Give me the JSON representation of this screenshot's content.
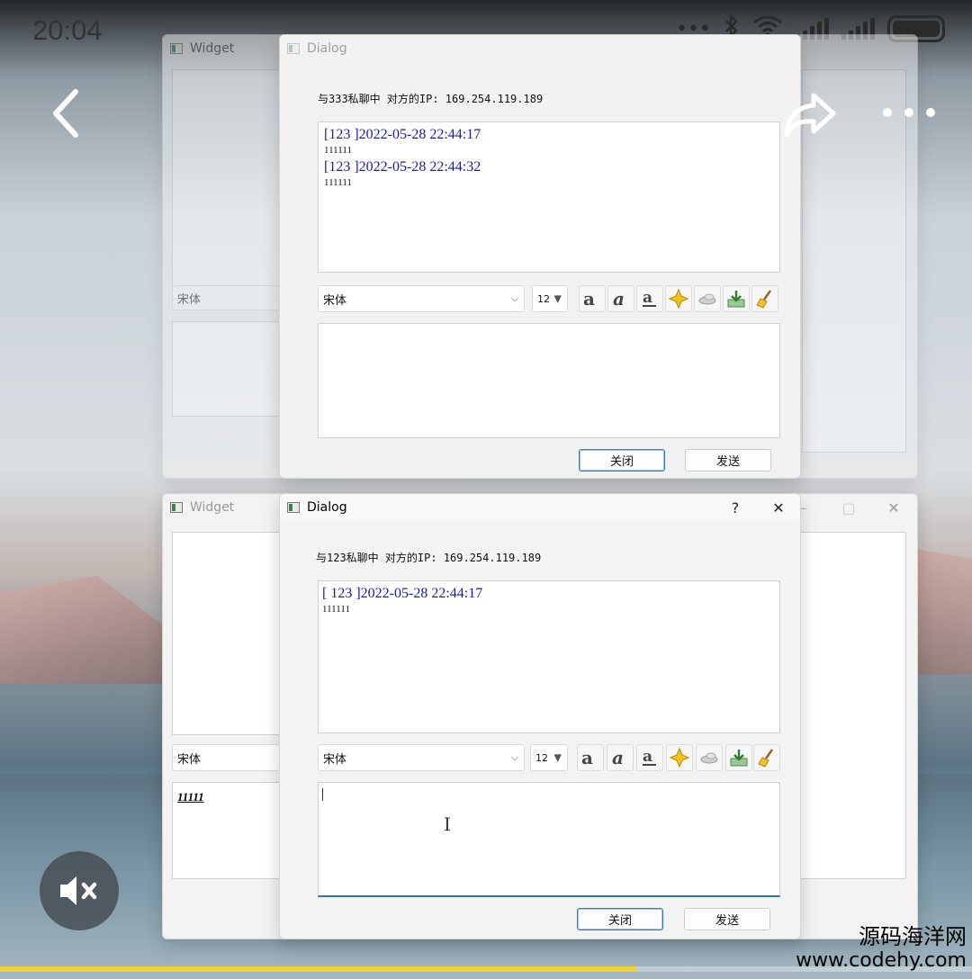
{
  "status_bar": {
    "time": "20:04"
  },
  "nav": {
    "back_icon": "chevron-left-icon",
    "share_icon": "share-icon",
    "more_icon": "more-icon"
  },
  "top_widget": {
    "title": "Widget",
    "font_combo": "宋体"
  },
  "top_dialog": {
    "title": "Dialog",
    "header": "与333私聊中 对方的IP: 169.254.119.189",
    "messages": [
      {
        "head": "[123 ]2022-05-28 22:44:17",
        "body": "111111"
      },
      {
        "head": "[123 ]2022-05-28 22:44:32",
        "body": "111111"
      }
    ],
    "font_combo": "宋体",
    "size_combo": "12",
    "close_label": "关闭",
    "send_label": "发送"
  },
  "bottom_widget": {
    "title": "Widget",
    "font_combo": "宋体",
    "input_text": "11111"
  },
  "bottom_dialog": {
    "title": "Dialog",
    "help": "?",
    "close_x": "✕",
    "header": "与123私聊中 对方的IP: 169.254.119.189",
    "messages": [
      {
        "head": "[ 123 ]2022-05-28 22:44:17",
        "body": "111111"
      }
    ],
    "font_combo": "宋体",
    "size_combo": "12",
    "close_label": "关闭",
    "send_label": "发送"
  },
  "video": {
    "progress": 0.655,
    "accent": "#f2d13a"
  },
  "watermark": {
    "line1": "源码海洋网",
    "line2": "www.codehy.com"
  }
}
